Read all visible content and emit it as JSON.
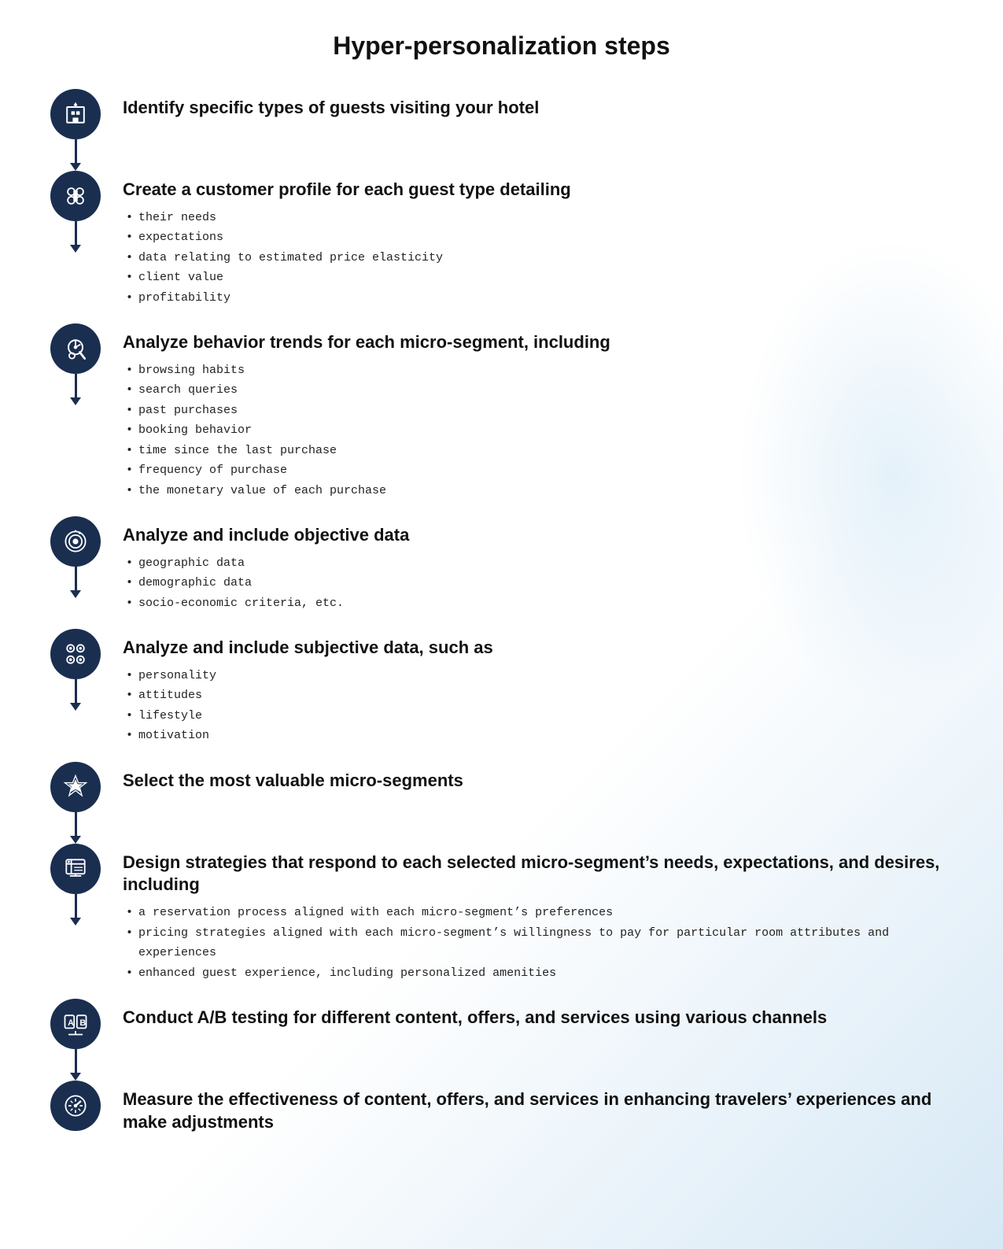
{
  "title": "Hyper-personalization steps",
  "steps": [
    {
      "id": "step1",
      "icon": "hotel",
      "heading": "Identify specific types of guests visiting your hotel",
      "list": []
    },
    {
      "id": "step2",
      "icon": "profile",
      "heading": "Create a customer profile for each guest type detailing",
      "list": [
        "their needs",
        "expectations",
        "data relating to estimated price elasticity",
        "client value",
        "profitability"
      ]
    },
    {
      "id": "step3",
      "icon": "analyze",
      "heading": "Analyze behavior trends for each micro-segment, including",
      "list": [
        "browsing habits",
        "search queries",
        "past purchases",
        "booking behavior",
        "time since the last purchase",
        "frequency of purchase",
        "the monetary value of each purchase"
      ]
    },
    {
      "id": "step4",
      "icon": "objective",
      "heading": "Analyze and include objective data",
      "list": [
        "geographic data",
        "demographic data",
        "socio-economic criteria, etc."
      ]
    },
    {
      "id": "step5",
      "icon": "subjective",
      "heading": "Analyze and include subjective data, such as",
      "list": [
        "personality",
        "attitudes",
        "lifestyle",
        "motivation"
      ]
    },
    {
      "id": "step6",
      "icon": "select",
      "heading": "Select the most valuable micro-segments",
      "list": []
    },
    {
      "id": "step7",
      "icon": "design",
      "heading": "Design strategies that respond to each selected micro-segment’s needs, expectations, and desires, including",
      "list": [
        "a reservation process aligned with each micro-segment’s preferences",
        "pricing strategies aligned with each micro-segment’s willingness\n    to pay for particular room attributes and experiences",
        "enhanced guest experience, including personalized amenities"
      ]
    },
    {
      "id": "step8",
      "icon": "ab-test",
      "heading": "Conduct A/B testing for different content, offers, and services using various channels",
      "list": []
    },
    {
      "id": "step9",
      "icon": "measure",
      "heading": "Measure the effectiveness of content, offers, and services in enhancing travelers’ experiences and make adjustments",
      "list": []
    }
  ]
}
